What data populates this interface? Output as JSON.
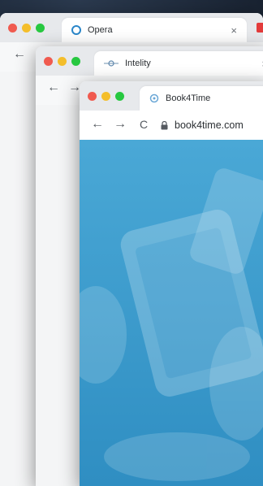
{
  "windows": [
    {
      "tab_title": "Opera",
      "close_label": "×"
    },
    {
      "tab_title": "Intelity",
      "close_label": "×"
    },
    {
      "tab_title": "Book4Time",
      "url": "book4time.com"
    }
  ],
  "nav": {
    "back": "←",
    "forward": "→",
    "reload": "C"
  },
  "colors": {
    "dot_red": "#f05a4f",
    "dot_yellow": "#f4be2b",
    "dot_green": "#27c840",
    "content_blue": "#3a9fd1"
  }
}
